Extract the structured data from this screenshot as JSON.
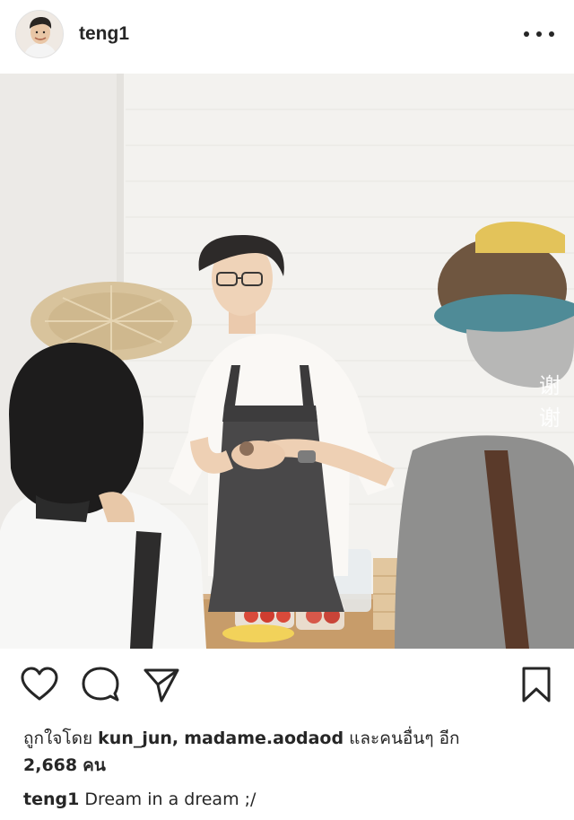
{
  "header": {
    "username": "teng1",
    "more_label": "•••"
  },
  "photo": {
    "watermark_line1": "谢",
    "watermark_line2": "谢"
  },
  "actions": {
    "like_icon": "heart-icon",
    "comment_icon": "comment-bubble-icon",
    "share_icon": "paper-plane-icon",
    "save_icon": "bookmark-icon"
  },
  "likes": {
    "prefix": "ถูกใจโดย",
    "user1": "kun_jun",
    "separator": ",",
    "user2": "madame.aodaod",
    "middle": "และคนอื่นๆ อีก",
    "count": "2,668",
    "suffix": "คน"
  },
  "caption": {
    "username": "teng1",
    "text": "Dream in a dream ;/"
  }
}
